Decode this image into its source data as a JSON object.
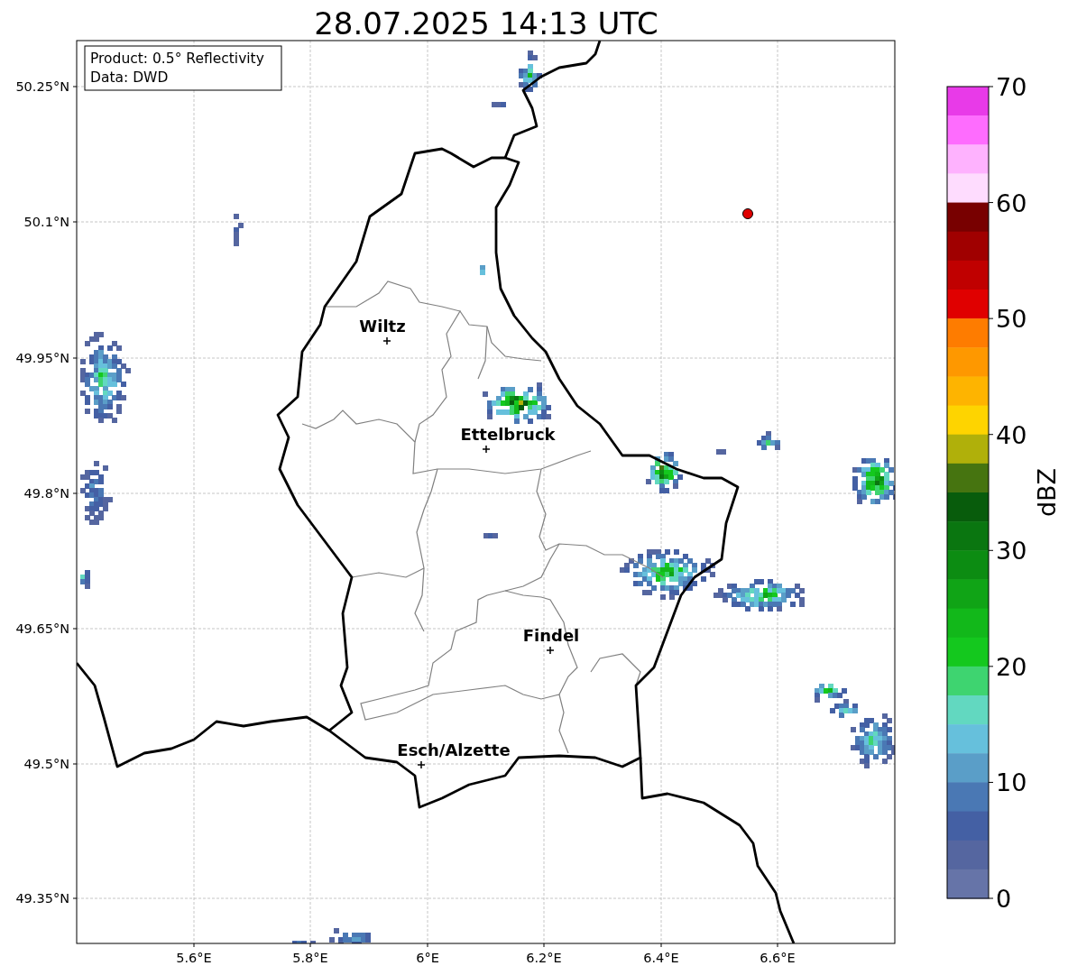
{
  "title": "28.07.2025 14:13 UTC",
  "info_box": [
    "Product: 0.5° Reflectivity",
    "Data: DWD"
  ],
  "y_ticks": [
    "50.25°N",
    "50.1°N",
    "49.95°N",
    "49.8°N",
    "49.65°N",
    "49.5°N",
    "49.35°N"
  ],
  "x_ticks": [
    "5.6°E",
    "5.8°E",
    "6°E",
    "6.2°E",
    "6.4°E",
    "6.6°E"
  ],
  "places": [
    {
      "name": "Wiltz"
    },
    {
      "name": "Ettelbruck"
    },
    {
      "name": "Findel"
    },
    {
      "name": "Esch/Alzette"
    }
  ],
  "colorbar": {
    "label": "dBZ",
    "ticks": [
      "70",
      "60",
      "50",
      "40",
      "30",
      "20",
      "10",
      "0"
    ],
    "bins": [
      {
        "color": "#e83ae8"
      },
      {
        "color": "#fe6cfe"
      },
      {
        "color": "#feb2fe"
      },
      {
        "color": "#fedcfe"
      },
      {
        "color": "#780000"
      },
      {
        "color": "#a00000"
      },
      {
        "color": "#c00000"
      },
      {
        "color": "#e00000"
      },
      {
        "color": "#fe7c00"
      },
      {
        "color": "#fe9800"
      },
      {
        "color": "#feb400"
      },
      {
        "color": "#fed400"
      },
      {
        "color": "#b0b00a"
      },
      {
        "color": "#467410"
      },
      {
        "color": "#085c0c"
      },
      {
        "color": "#0a7610"
      },
      {
        "color": "#0c8c12"
      },
      {
        "color": "#10a416"
      },
      {
        "color": "#12b81a"
      },
      {
        "color": "#14c81e"
      },
      {
        "color": "#3ed470"
      },
      {
        "color": "#62d8c0"
      },
      {
        "color": "#66c0dc"
      },
      {
        "color": "#5a9ec8"
      },
      {
        "color": "#4a78b4"
      },
      {
        "color": "#4460a4"
      },
      {
        "color": "#5566a0"
      },
      {
        "color": "#6674a8"
      }
    ]
  }
}
